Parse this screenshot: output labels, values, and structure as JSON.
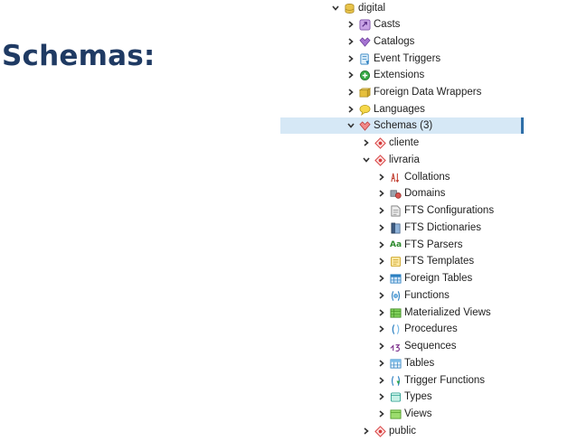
{
  "heading": "Schemas:",
  "tree": {
    "database": "digital",
    "casts": "Casts",
    "catalogs": "Catalogs",
    "event_triggers": "Event Triggers",
    "extensions": "Extensions",
    "fdw": "Foreign Data Wrappers",
    "languages": "Languages",
    "schemas": "Schemas (3)",
    "schema_cliente": "cliente",
    "schema_livraria": "livraria",
    "collations": "Collations",
    "domains": "Domains",
    "fts_configurations": "FTS Configurations",
    "fts_dictionaries": "FTS Dictionaries",
    "fts_parsers": "FTS Parsers",
    "fts_templates": "FTS Templates",
    "foreign_tables": "Foreign Tables",
    "functions": "Functions",
    "materialized_views": "Materialized Views",
    "procedures": "Procedures",
    "sequences": "Sequences",
    "tables": "Tables",
    "trigger_functions": "Trigger Functions",
    "types": "Types",
    "views": "Views",
    "schema_public": "public",
    "parsers_glyph": "Aa"
  },
  "colors": {
    "heading": "#1f3a63",
    "selection": "#d6e8f6",
    "selection_bar": "#2f6fa8"
  }
}
